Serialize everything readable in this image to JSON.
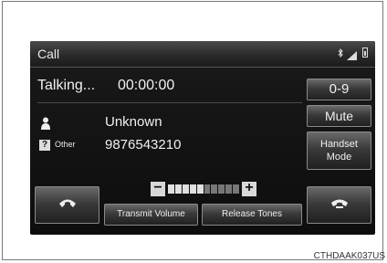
{
  "header": {
    "title": "Call",
    "status_icons": [
      "bluetooth-icon",
      "signal-icon",
      "battery-icon"
    ]
  },
  "call": {
    "state": "Talking...",
    "duration": "00:00:00",
    "contact_name": "Unknown",
    "phone_type": "Other",
    "phone_number": "9876543210"
  },
  "buttons": {
    "keypad": "0-9",
    "mute": "Mute",
    "handset_line1": "Handset",
    "handset_line2": "Mode",
    "transmit_volume": "Transmit Volume",
    "release_tones": "Release Tones",
    "volume_minus": "−",
    "volume_plus": "+"
  },
  "volume": {
    "level": 5,
    "max": 10
  },
  "icons": {
    "call": "phone-pickup-icon",
    "end": "phone-hangup-icon",
    "person": "person-icon",
    "phone_type": "question-icon"
  },
  "colors": {
    "screen_bg": "#111111",
    "text": "#f0f0f0",
    "button_border": "#8a8a8a"
  },
  "caption": "CTHDAAK037US"
}
